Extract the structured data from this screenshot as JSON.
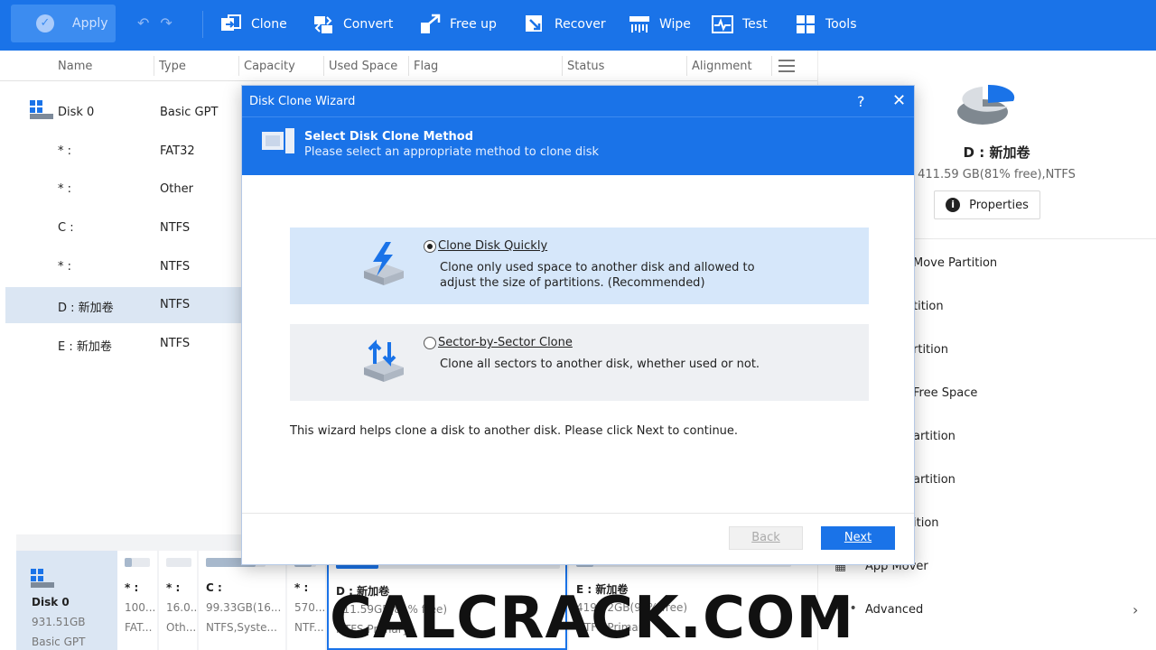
{
  "toolbar": {
    "apply_label": "Apply",
    "items": [
      {
        "label": "Clone",
        "icon": "clone-icon"
      },
      {
        "label": "Convert",
        "icon": "convert-icon"
      },
      {
        "label": "Free up",
        "icon": "free-up-icon"
      },
      {
        "label": "Recover",
        "icon": "recover-icon"
      },
      {
        "label": "Wipe",
        "icon": "wipe-icon"
      },
      {
        "label": "Test",
        "icon": "test-icon"
      },
      {
        "label": "Tools",
        "icon": "tools-icon"
      }
    ]
  },
  "table": {
    "headers": [
      "Name",
      "Type",
      "Capacity",
      "Used Space",
      "Flag",
      "Status",
      "Alignment"
    ],
    "rows": [
      {
        "name": "Disk 0",
        "type": "Basic GPT",
        "selected": false
      },
      {
        "name": "* :",
        "type": "FAT32",
        "selected": false
      },
      {
        "name": "* :",
        "type": "Other",
        "selected": false
      },
      {
        "name": "C :",
        "type": "NTFS",
        "selected": false
      },
      {
        "name": "* :",
        "type": "NTFS",
        "selected": false
      },
      {
        "name": "D : 新加卷",
        "type": "NTFS",
        "selected": true
      },
      {
        "name": "E : 新加卷",
        "type": "NTFS",
        "selected": false
      }
    ]
  },
  "right_panel": {
    "title": "D : 新加卷",
    "subtitle": "411.59 GB(81% free),NTFS",
    "properties_label": "Properties",
    "operations": [
      "Move Partition",
      "tition",
      "rtition",
      "Free Space",
      "artition",
      "artition",
      "ition",
      "App Mover",
      "Advanced"
    ]
  },
  "disk_map": {
    "disk_label": "Disk 0",
    "disk_size": "931.51GB",
    "disk_type": "Basic GPT",
    "partitions": [
      {
        "l1": "* :",
        "l2": "100...",
        "l3": "FAT...",
        "used": 0.3
      },
      {
        "l1": "* :",
        "l2": "16.0...",
        "l3": "Oth...",
        "used": 0.0
      },
      {
        "l1": "C :",
        "l2": "99.33GB(16...",
        "l3": "NTFS,Syste...",
        "used": 0.84
      },
      {
        "l1": "* :",
        "l2": "570...",
        "l3": "NTF...",
        "used": 0.8
      },
      {
        "l1": "D : 新加卷",
        "l2": "411.59GB(81% free)",
        "l3": "NTFS,Primary",
        "used": 0.19
      },
      {
        "l1": "E : 新加卷",
        "l2": "419.92GB(95% free)",
        "l3": "NTFS,Primary",
        "used": 0.08
      }
    ]
  },
  "dialog": {
    "title": "Disk Clone Wizard",
    "help": "?",
    "close": "✕",
    "header_title": "Select Disk Clone Method",
    "header_subtitle": "Please select an appropriate method to clone disk",
    "option1_title": "Clone Disk Quickly",
    "option1_desc1": "Clone only used space to another disk and allowed to",
    "option1_desc2": "adjust the size of partitions. (Recommended)",
    "option2_title": "Sector-by-Sector Clone",
    "option2_desc1": "Clone all sectors to another disk, whether used or not.",
    "note": "This wizard helps clone a disk to another disk. Please click Next to continue.",
    "back_label": "Back",
    "next_label": "Next",
    "selected_option": 1
  },
  "watermark": "CALCRACK.COM",
  "colors": {
    "accent": "#1a73e8",
    "selected_row": "#dbe6f3",
    "option_selected": "#d6e7fa"
  }
}
